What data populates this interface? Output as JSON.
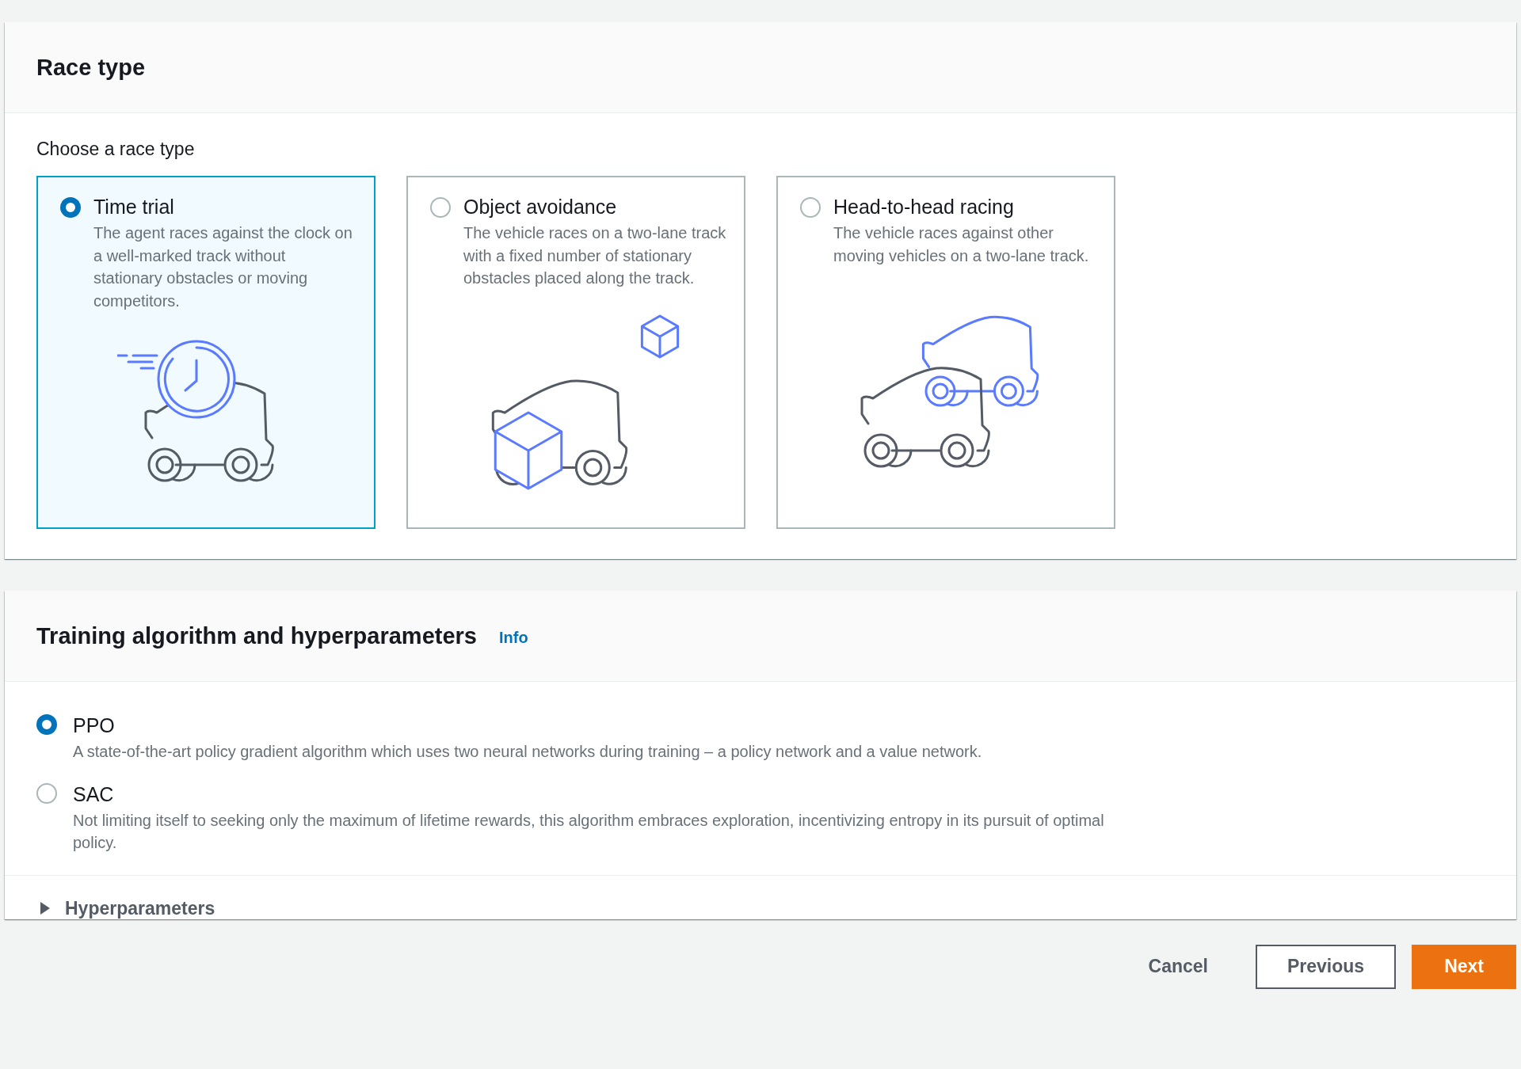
{
  "race_type": {
    "title": "Race type",
    "prompt": "Choose a race type",
    "options": [
      {
        "label": "Time trial",
        "description": "The agent races against the clock on a well-marked track without stationary obstacles or moving competitors.",
        "selected": true,
        "kind": "clock"
      },
      {
        "label": "Object avoidance",
        "description": "The vehicle races on a two-lane track with a fixed number of stationary obstacles placed along the track.",
        "selected": false,
        "kind": "obstacles"
      },
      {
        "label": "Head-to-head racing",
        "description": "The vehicle races against other moving vehicles on a two-lane track.",
        "selected": false,
        "kind": "opponent"
      }
    ]
  },
  "training": {
    "title": "Training algorithm and hyperparameters",
    "info_link": "Info",
    "options": [
      {
        "label": "PPO",
        "description": "A state-of-the-art policy gradient algorithm which uses two neural networks during training – a policy network and a value network.",
        "selected": true
      },
      {
        "label": "SAC",
        "description": "Not limiting itself to seeking only the maximum of lifetime rewards, this algorithm embraces exploration, incentivizing entropy in its pursuit of optimal policy.",
        "selected": false
      }
    ],
    "hyperparameters": {
      "label": "Hyperparameters",
      "expanded": false
    }
  },
  "buttons": [
    {
      "label": "Cancel",
      "kind": "link"
    },
    {
      "label": "Previous",
      "kind": "normal"
    },
    {
      "label": "Next",
      "kind": "primary"
    }
  ]
}
